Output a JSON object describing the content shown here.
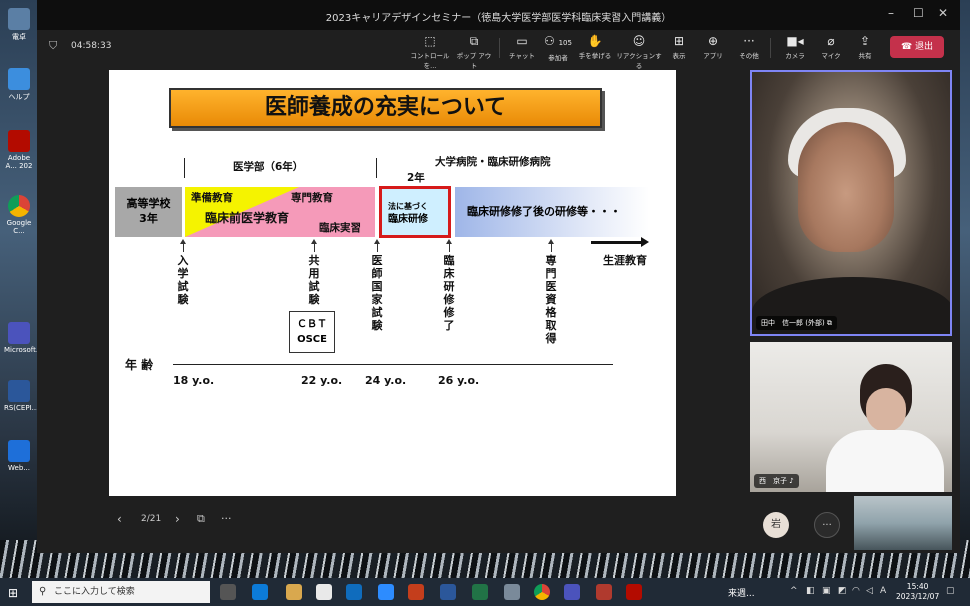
{
  "window": {
    "title": "2023キャリアデザインセミナー（徳島大学医学部医学科臨床実習入門講義）"
  },
  "toolbar": {
    "timer": "04:58:33",
    "buttons": [
      {
        "label": "コントロールを...",
        "icon": "control-icon"
      },
      {
        "label": "ポップ アウト",
        "icon": "popout-icon"
      },
      {
        "label": "チャット",
        "icon": "chat-icon"
      },
      {
        "label": "参加者",
        "icon": "people-icon",
        "count": "105"
      },
      {
        "label": "手を挙げる",
        "icon": "hand-icon"
      },
      {
        "label": "リアクションする",
        "icon": "smile-icon"
      },
      {
        "label": "表示",
        "icon": "view-icon"
      },
      {
        "label": "アプリ",
        "icon": "apps-icon"
      },
      {
        "label": "その他",
        "icon": "more-icon"
      },
      {
        "label": "カメラ",
        "icon": "camera-icon"
      },
      {
        "label": "マイク",
        "icon": "mic-off-icon"
      },
      {
        "label": "共有",
        "icon": "share-icon"
      }
    ],
    "leave_label": "退出"
  },
  "slide": {
    "title": "医師養成の充実について",
    "faculty": "医学部（6年）",
    "hospital": "大学病院・臨床研修病院",
    "two_years": "2年",
    "high_school_1": "高等学校",
    "high_school_2": "3年",
    "prep": "準備教育",
    "specialty": "専門教育",
    "preclinical": "臨床前医学教育",
    "clinical_practice": "臨床実習",
    "clinical_training_1": "法に基づく",
    "clinical_training_2": "臨床研修",
    "after_training": "臨床研修修了後の研修等・・・",
    "lifelong": "生涯教育",
    "entrance_exam": "入学試験",
    "common_exam": "共用試験",
    "national_exam": "医師国家試験",
    "training_done": "臨床研修修了",
    "specialist": "専門医資格取得",
    "cbt": "ＣＢＴ",
    "osce": "OSCE",
    "age_label": "年 齢",
    "ages": [
      "18 y.o.",
      "22 y.o.",
      "24 y.o.",
      "26 y.o."
    ]
  },
  "slide_nav": {
    "page": "2/21"
  },
  "participants": [
    {
      "name": "田中　信一郎 (外部)"
    },
    {
      "name": "西　京子"
    }
  ],
  "avatar": {
    "initial": "岩"
  },
  "video3": {
    "label": ""
  },
  "desktop_icons": [
    "電卓",
    "ヘルプ",
    "Adobe A... 202",
    "Google C...",
    "Microsoft...",
    "RS(CEPI...",
    "Web..."
  ],
  "taskbar": {
    "search_placeholder": "ここに入力して検索",
    "weather": "来週...",
    "time": "15:40",
    "date": "2023/12/07",
    "ime": "A"
  }
}
